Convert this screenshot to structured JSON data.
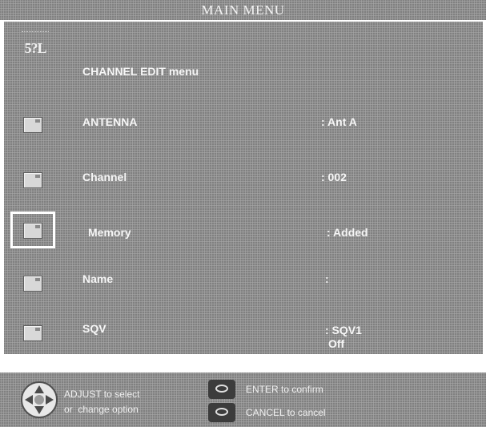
{
  "menu": {
    "title": "MAIN MENU",
    "header": {
      "icon": "channel-edit-icon",
      "icon_text": "5?L",
      "label": "CHANNEL EDIT menu"
    },
    "rows": [
      {
        "label": "ANTENNA",
        "value": ": Ant A",
        "selected": false
      },
      {
        "label": "Channel",
        "value": ": 002",
        "selected": false
      },
      {
        "label": "Memory",
        "value": ": Added",
        "selected": true
      },
      {
        "label": "Name",
        "value": ":",
        "selected": false
      },
      {
        "label": "SQV",
        "value": ": SQV1",
        "value_sub": "Off",
        "selected": false
      }
    ]
  },
  "footer": {
    "adjust_line1": "ADJUST to select",
    "adjust_line2": "or  change option",
    "enter_text": "ENTER to confirm",
    "cancel_text": "CANCEL to cancel"
  },
  "colors": {
    "panel": "#8e8e8e",
    "text": "#f6f6f6",
    "selection_frame": "#ffffff"
  }
}
